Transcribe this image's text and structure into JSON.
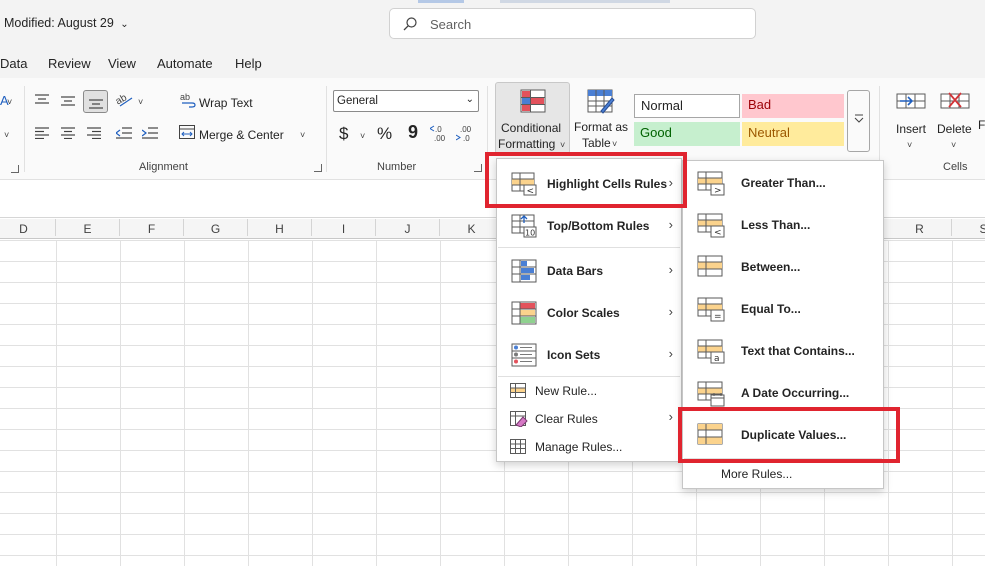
{
  "title_bar": {
    "modified": "Modified: August 29",
    "search_placeholder": "Search"
  },
  "tabs": [
    "Data",
    "Review",
    "View",
    "Automate",
    "Help"
  ],
  "ribbon": {
    "alignment": {
      "wrap_text": "Wrap Text",
      "merge_center": "Merge & Center",
      "label": "Alignment"
    },
    "number": {
      "format": "General",
      "label": "Number",
      "currency": "$",
      "percent": "%",
      "comma": "9"
    },
    "conditional_formatting": {
      "line1": "Conditional",
      "line2": "Formatting"
    },
    "format_as_table": {
      "line1": "Format as",
      "line2": "Table"
    },
    "styles": {
      "normal": "Normal",
      "bad": "Bad",
      "good": "Good",
      "neutral": "Neutral"
    },
    "cells": {
      "insert": "Insert",
      "delete": "Delete",
      "label": "Cells"
    },
    "left_glyph": "A"
  },
  "columns": [
    "D",
    "E",
    "F",
    "G",
    "H",
    "I",
    "J",
    "K",
    "R",
    "S"
  ],
  "cf_menu": {
    "items": [
      "Highlight Cells Rules",
      "Top/Bottom Rules",
      "Data Bars",
      "Color Scales",
      "Icon Sets"
    ],
    "rules": [
      "New Rule...",
      "Clear Rules",
      "Manage Rules..."
    ]
  },
  "highlight_submenu": {
    "items": [
      "Greater Than...",
      "Less Than...",
      "Between...",
      "Equal To...",
      "Text that Contains...",
      "A Date Occurring...",
      "Duplicate Values..."
    ],
    "more": "More Rules..."
  },
  "colors": {
    "accent_red": "#e0242f",
    "bad_bg": "#ffc7ce",
    "good_bg": "#c6efce",
    "neutral_bg": "#ffeb9c"
  }
}
